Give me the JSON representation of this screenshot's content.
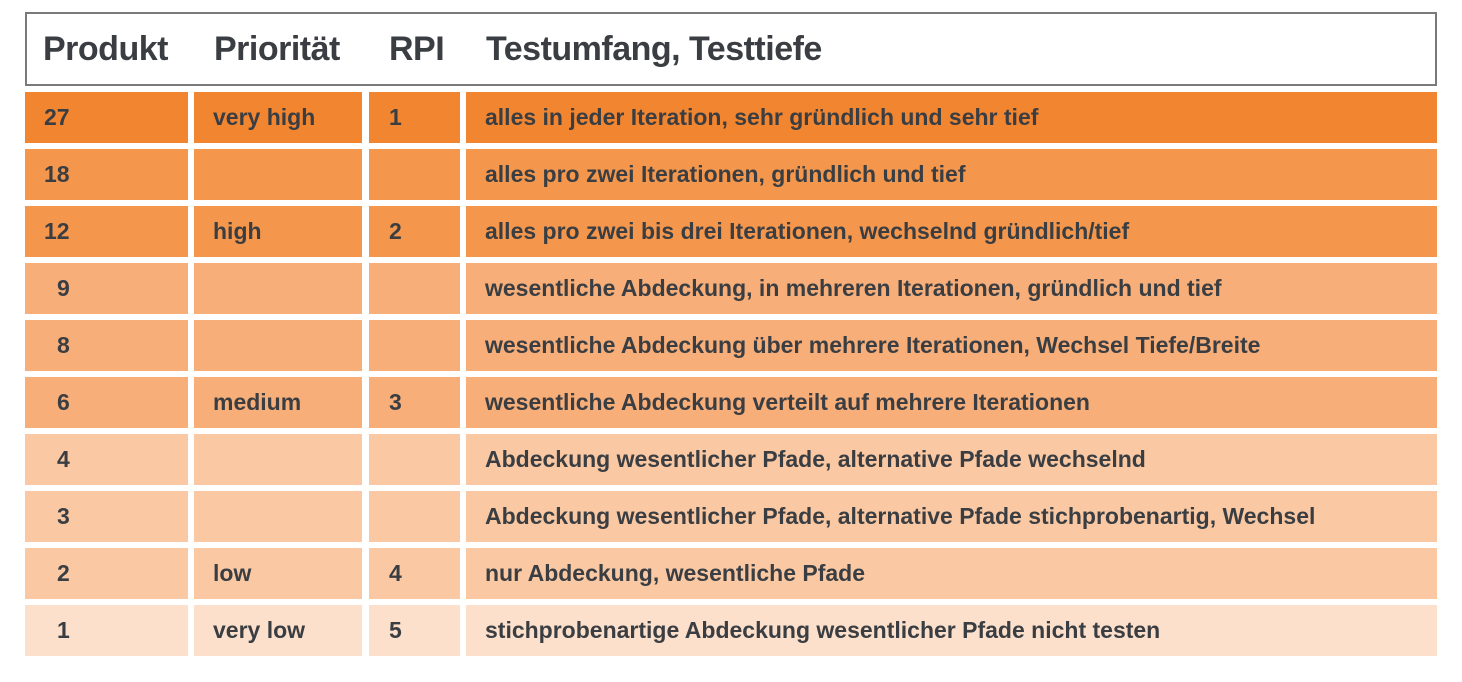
{
  "table": {
    "headers": {
      "produkt": "Produkt",
      "prioritaet": "Priorität",
      "rpi": "RPI",
      "testumfang": "Testumfang, Testtiefe"
    },
    "rows": [
      {
        "produkt": "27",
        "prioritaet": "very high",
        "rpi": "1",
        "testumfang": "alles in jeder Iteration, sehr gründlich und sehr tief",
        "color": "#f28530"
      },
      {
        "produkt": "18",
        "prioritaet": "",
        "rpi": "",
        "testumfang": "alles pro zwei Iterationen, gründlich und tief",
        "color": "#f4974c"
      },
      {
        "produkt": "12",
        "prioritaet": "high",
        "rpi": "2",
        "testumfang": "alles pro zwei bis drei Iterationen, wechselnd gründlich/tief",
        "color": "#f4974c"
      },
      {
        "produkt": "9",
        "prioritaet": "",
        "rpi": "",
        "testumfang": "wesentliche Abdeckung, in mehreren Iterationen, gründlich und tief",
        "color": "#f7ae79"
      },
      {
        "produkt": "8",
        "prioritaet": "",
        "rpi": "",
        "testumfang": "wesentliche Abdeckung über mehrere Iterationen, Wechsel Tiefe/Breite",
        "color": "#f7ae79"
      },
      {
        "produkt": "6",
        "prioritaet": "medium",
        "rpi": "3",
        "testumfang": "wesentliche Abdeckung verteilt auf mehrere Iterationen",
        "color": "#f7ae79"
      },
      {
        "produkt": "4",
        "prioritaet": "",
        "rpi": "",
        "testumfang": "Abdeckung wesentlicher Pfade, alternative Pfade wechselnd",
        "color": "#fac9a3"
      },
      {
        "produkt": "3",
        "prioritaet": "",
        "rpi": "",
        "testumfang": "Abdeckung wesentlicher Pfade, alternative Pfade stichprobenartig, Wechsel",
        "color": "#fac9a3"
      },
      {
        "produkt": "2",
        "prioritaet": "low",
        "rpi": "4",
        "testumfang": "nur Abdeckung, wesentliche Pfade",
        "color": "#fac9a3"
      },
      {
        "produkt": "1",
        "prioritaet": "very low",
        "rpi": "5",
        "testumfang": "stichprobenartige Abdeckung wesentlicher Pfade nicht testen",
        "color": "#fce0cb"
      }
    ]
  }
}
